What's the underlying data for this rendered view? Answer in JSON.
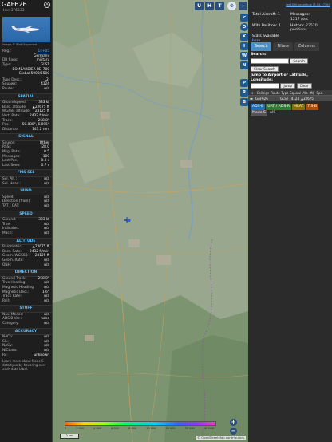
{
  "selected": {
    "callsign": "GAF626",
    "hex_label": "Hex:",
    "hex": "3F6533",
    "photo_caption": "Image © Bird Degraded",
    "reg_label": "Reg.:",
    "reg": "14+05",
    "country": "Germany",
    "db_flags_label": "DB flags:",
    "db_flags": "military",
    "type_label": "Type:",
    "type": "GLST",
    "type_desc": "BOMBARDIER BD-700 Global 5000/5500",
    "type_desc_label": "Type Desc.:",
    "type_desc_code": "L2J",
    "squawk_label": "Squawk:",
    "squawk": "4124",
    "route_label": "Route:",
    "route": "n/a"
  },
  "sections": {
    "spatial": "SPATIAL",
    "signal": "SIGNAL",
    "fms_sel": "FMS SEL",
    "wind": "WIND",
    "speed": "SPEED",
    "altitude": "ALTITUDE",
    "direction": "DIRECTION",
    "stuff": "STUFF",
    "accuracy": "ACCURACY"
  },
  "spatial": [
    {
      "k": "Groundspeed:",
      "v": "383 kt"
    },
    {
      "k": "Baro. altitude:",
      "v": "▲22675 ft"
    },
    {
      "k": "WGS84 altitude:",
      "v": "23125 ft"
    },
    {
      "k": "Vert. Rate:",
      "v": "2432 ft/min"
    },
    {
      "k": "Track:",
      "v": "268.8°"
    },
    {
      "k": "Pos.:",
      "v": "50.830°, 6.095°"
    },
    {
      "k": "Distance:",
      "v": "141.2 nmi"
    }
  ],
  "signal": [
    {
      "k": "Source:",
      "v": "Other"
    },
    {
      "k": "RSSI:",
      "v": "-28.0"
    },
    {
      "k": "Msg. Rate:",
      "v": "0.5"
    },
    {
      "k": "Messages:",
      "v": "100"
    },
    {
      "k": "Last Pos.:",
      "v": "0.3 s"
    },
    {
      "k": "Last Seen:",
      "v": "0.7 s"
    }
  ],
  "fms": [
    {
      "k": "Sel. Alt.:",
      "v": "n/a"
    },
    {
      "k": "Sel. Head.:",
      "v": "n/a"
    }
  ],
  "wind": [
    {
      "k": "Speed:",
      "v": "n/a"
    },
    {
      "k": "Direction (from):",
      "v": "n/a"
    },
    {
      "k": "TAT / OAT:",
      "v": "n/a"
    }
  ],
  "speed": [
    {
      "k": "Ground:",
      "v": "383 kt"
    },
    {
      "k": "True:",
      "v": "n/a"
    },
    {
      "k": "Indicated:",
      "v": "n/a"
    },
    {
      "k": "Mach:",
      "v": "n/a"
    }
  ],
  "altitude": [
    {
      "k": "Barometric:",
      "v": "▲22675 ft"
    },
    {
      "k": "Baro. Rate:",
      "v": "2432 ft/min"
    },
    {
      "k": "Geom. WGS84:",
      "v": "23125 ft"
    },
    {
      "k": "Geom. Rate:",
      "v": "n/a"
    },
    {
      "k": "QNH:",
      "v": "n/a"
    }
  ],
  "direction": [
    {
      "k": "Ground Track:",
      "v": "268.8°"
    },
    {
      "k": "True Heading:",
      "v": "n/a"
    },
    {
      "k": "Magnetic Heading:",
      "v": "n/a"
    },
    {
      "k": "Magnetic Decl.:",
      "v": "1.6°"
    },
    {
      "k": "Track Rate:",
      "v": "n/a"
    },
    {
      "k": "Roll:",
      "v": "n/a"
    }
  ],
  "stuff": [
    {
      "k": "Nav. Modes:",
      "v": "n/a"
    },
    {
      "k": "ADS-B Ver.:",
      "v": "none"
    },
    {
      "k": "Category:",
      "v": "n/a"
    }
  ],
  "accuracy": [
    {
      "k": "NACp:",
      "v": "n/a"
    },
    {
      "k": "SIL:",
      "v": "n/a"
    },
    {
      "k": "NACv:",
      "v": "n/a"
    },
    {
      "k": "NICbaro:",
      "v": "n/a"
    },
    {
      "k": "Rc:",
      "v": "unknown"
    }
  ],
  "footnote": "Learn more about Mode S data type by hovering over each data label.",
  "map": {
    "buttons_top": [
      "U",
      "H",
      "T"
    ],
    "side_buttons": [
      "<",
      "O",
      "K",
      "I",
      "W",
      "N",
      "P",
      "R",
      "B"
    ],
    "zoom_in": "+",
    "zoom_out": "−",
    "scale": "2 km",
    "attribution": "© OpenStreetMap contributors.",
    "legend_ticks": [
      "0",
      "2 000",
      "4 000",
      "6 000",
      "8 000",
      "10 000",
      "20 000",
      "30 000",
      "40 000+"
    ],
    "aircraft_label": "GAF626"
  },
  "right": {
    "github": "tar1090 on github (3.14.1736)",
    "total_label": "Total Aircraft:",
    "total": "1",
    "messages_label": "Messages:",
    "messages": "1217 /sec",
    "with_pos_label": "With Position:",
    "with_pos": "1",
    "history_label": "History:",
    "history": "23520 positions",
    "stats_label": "Stats available",
    "stats_link": "here",
    "tabs": [
      "Search",
      "Filters",
      "Columns"
    ],
    "search_label": "Search:",
    "search_button": "Search",
    "clear_button": "Clear Search",
    "jump_label": "Jump to Airport or Latitude, Longitude:",
    "jump_button": "Jump",
    "clear_button2": "Clear",
    "columns": [
      "Callsign",
      "Route",
      "Type",
      "Squawk",
      "Alt. (ft)",
      "Spd."
    ],
    "rows": [
      {
        "callsign": "GAF626",
        "route": "",
        "type": "GLST",
        "squawk": "4124",
        "alt": "▲22675",
        "spd": ""
      }
    ],
    "tags": [
      "ADS-B",
      "UAT / ADS-R",
      "MLAT",
      "TIS-B",
      "Mode S",
      "AIS"
    ]
  },
  "colors": {
    "accent": "#5cc1ff",
    "map_button": "#2a4d79",
    "tab_active": "#4a90c4"
  }
}
